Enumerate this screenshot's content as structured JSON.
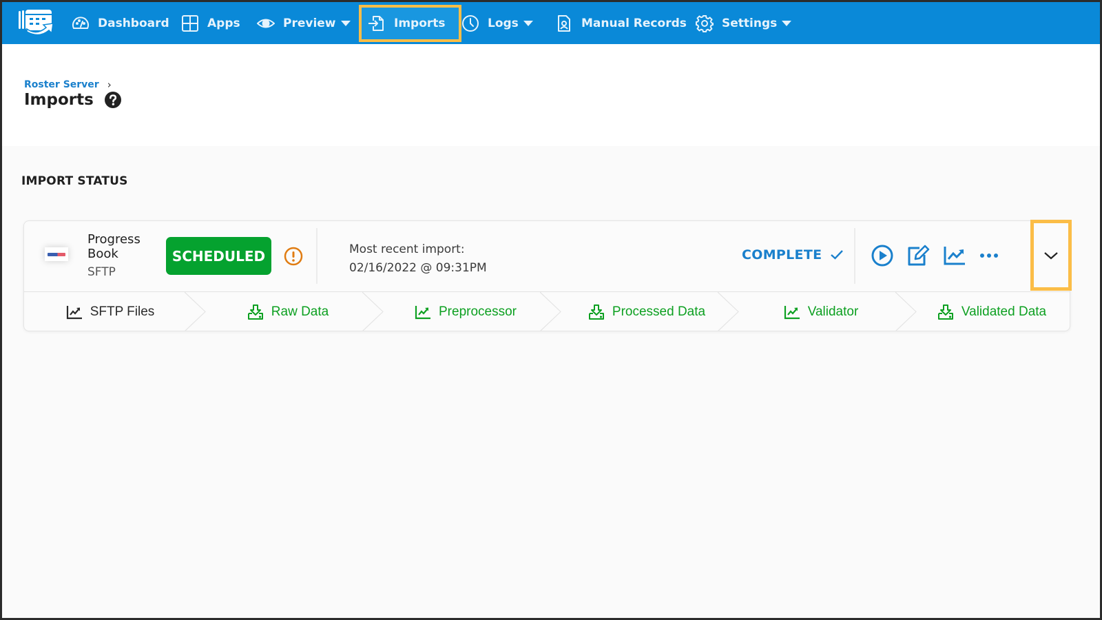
{
  "nav": {
    "items": [
      {
        "label": "Dashboard",
        "icon": "dashboard-gauge-icon"
      },
      {
        "label": "Apps",
        "icon": "grid-icon"
      },
      {
        "label": "Preview",
        "icon": "eye-icon",
        "dropdown": true
      },
      {
        "label": "Imports",
        "icon": "import-file-icon",
        "active": true
      },
      {
        "label": "Logs",
        "icon": "clock-icon",
        "dropdown": true
      },
      {
        "label": "Manual Records",
        "icon": "user-document-icon"
      },
      {
        "label": "Settings",
        "icon": "gear-icon",
        "dropdown": true
      }
    ]
  },
  "header": {
    "breadcrumb": "Roster Server",
    "title": "Imports"
  },
  "section_title": "IMPORT STATUS",
  "import": {
    "app_name": "Progress Book",
    "app_name_line1": "Progress",
    "app_name_line2": "Book",
    "type": "SFTP",
    "status_badge": "SCHEDULED",
    "recent_label": "Most recent import:",
    "recent_time": "02/16/2022 @ 09:31PM",
    "result": "COMPLETE",
    "actions": [
      "run",
      "edit",
      "analytics",
      "more",
      "expand"
    ],
    "steps": [
      {
        "label": "SFTP Files",
        "icon": "chart-line-icon",
        "enabled": false
      },
      {
        "label": "Raw Data",
        "icon": "download-tray-icon",
        "enabled": true
      },
      {
        "label": "Preprocessor",
        "icon": "chart-line-icon",
        "enabled": true
      },
      {
        "label": "Processed Data",
        "icon": "download-tray-icon",
        "enabled": true
      },
      {
        "label": "Validator",
        "icon": "chart-line-icon",
        "enabled": true
      },
      {
        "label": "Validated Data",
        "icon": "download-tray-icon",
        "enabled": true
      }
    ]
  },
  "colors": {
    "nav_bg": "#0a89d8",
    "highlight": "#fbbd47",
    "scheduled": "#05a22f",
    "complete": "#1a80cc",
    "warning": "#e07c12",
    "step_green": "#0da021"
  }
}
